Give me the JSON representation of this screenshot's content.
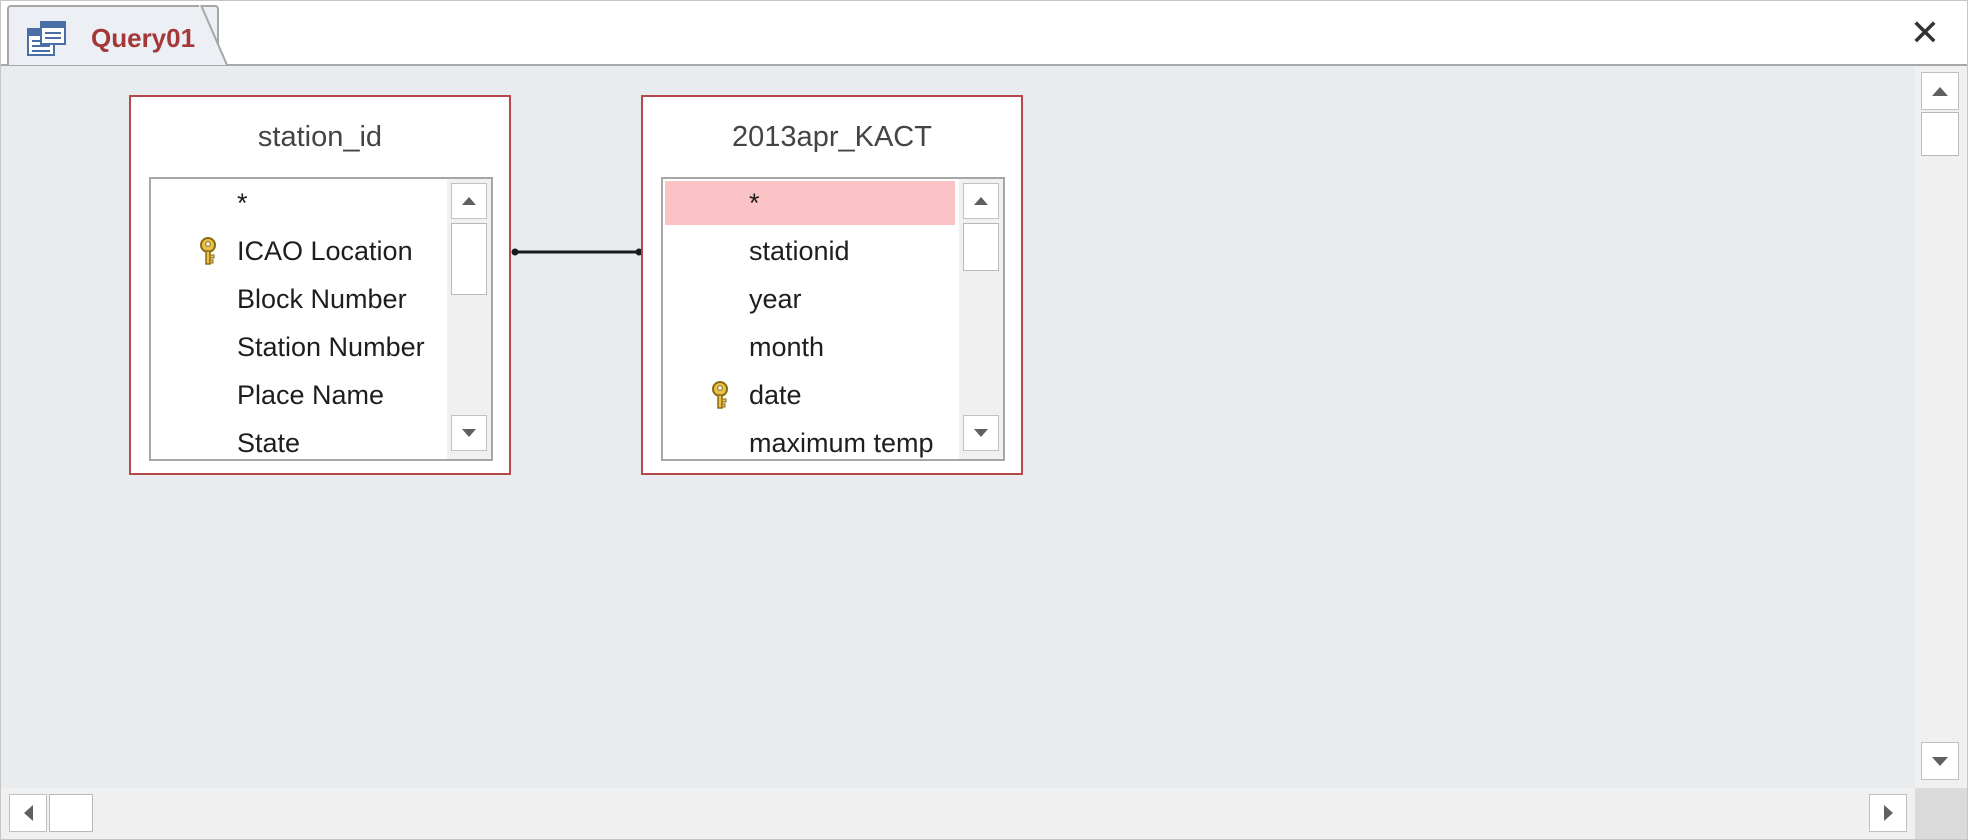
{
  "tab": {
    "title": "Query01",
    "icon": "query-icon"
  },
  "window": {
    "close_label": "✕"
  },
  "tables": [
    {
      "name": "station_id",
      "fields": [
        {
          "label": "*",
          "primary_key": false,
          "selected": false
        },
        {
          "label": "ICAO Location",
          "primary_key": true,
          "selected": false
        },
        {
          "label": "Block Number",
          "primary_key": false,
          "selected": false
        },
        {
          "label": "Station Number",
          "primary_key": false,
          "selected": false
        },
        {
          "label": "Place Name",
          "primary_key": false,
          "selected": false
        },
        {
          "label": "State",
          "primary_key": false,
          "selected": false
        }
      ]
    },
    {
      "name": "2013apr_KACT",
      "fields": [
        {
          "label": "*",
          "primary_key": false,
          "selected": true
        },
        {
          "label": "stationid",
          "primary_key": false,
          "selected": false
        },
        {
          "label": "year",
          "primary_key": false,
          "selected": false
        },
        {
          "label": "month",
          "primary_key": false,
          "selected": false
        },
        {
          "label": "date",
          "primary_key": true,
          "selected": false
        },
        {
          "label": "maximum temp",
          "primary_key": false,
          "selected": false
        }
      ]
    }
  ],
  "relationship": {
    "from_table": "station_id",
    "from_field": "ICAO Location",
    "to_table": "2013apr_KACT",
    "to_field": "stationid"
  },
  "colors": {
    "accent": "#a4373a",
    "table_border": "#b7474b",
    "selected_row": "#fbc3c5",
    "design_background": "#e9ecef"
  }
}
